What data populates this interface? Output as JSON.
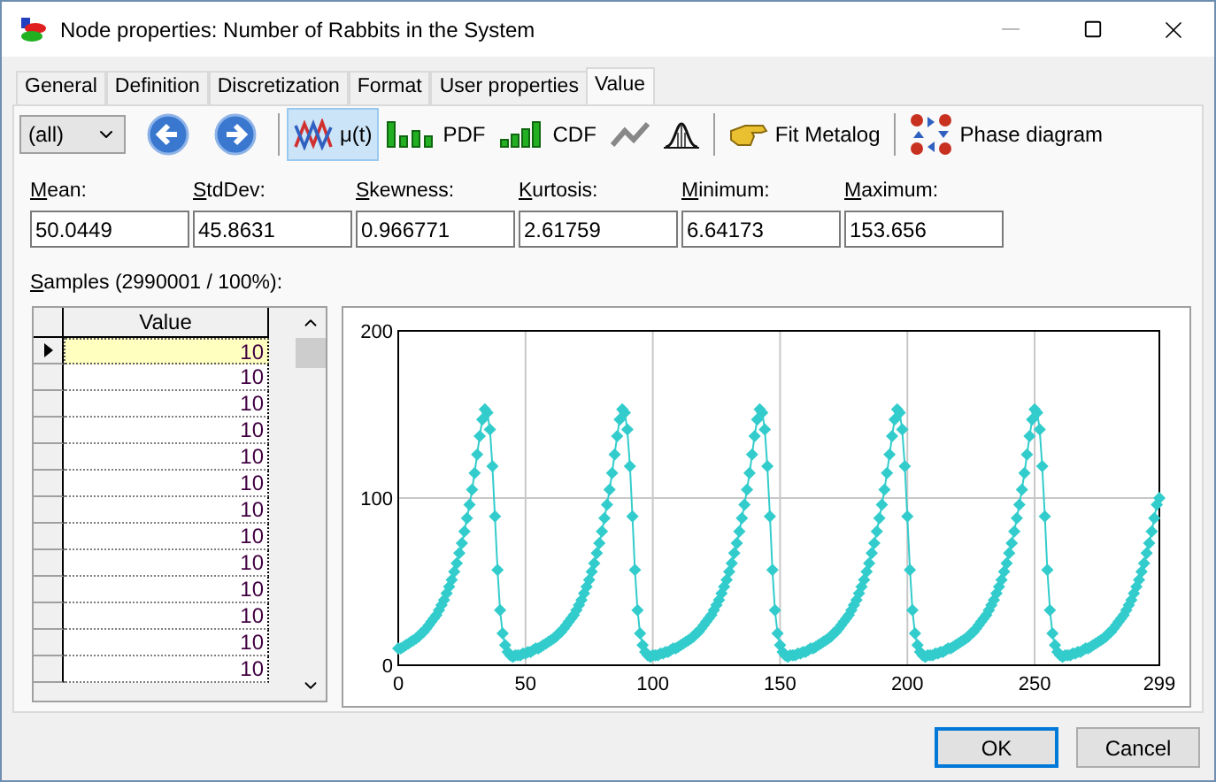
{
  "window": {
    "title": "Node properties: Number of Rabbits in the System"
  },
  "tabs": [
    {
      "label": "General",
      "selected": false
    },
    {
      "label": "Definition",
      "selected": false
    },
    {
      "label": "Discretization",
      "selected": false
    },
    {
      "label": "Format",
      "selected": false
    },
    {
      "label": "User properties",
      "selected": false
    },
    {
      "label": "Value",
      "selected": true
    }
  ],
  "toolbar": {
    "filter": {
      "value": "(all)"
    },
    "groups": [
      [
        {
          "kind": "back"
        },
        {
          "kind": "forward"
        }
      ],
      [
        {
          "kind": "trend",
          "label": "μ(t)",
          "selected": true
        },
        {
          "kind": "pdf",
          "label": "PDF",
          "selected": false
        },
        {
          "kind": "cdf",
          "label": "CDF",
          "selected": false
        },
        {
          "kind": "line",
          "selected": false
        },
        {
          "kind": "bell",
          "selected": false
        }
      ],
      [
        {
          "kind": "fit",
          "label": "Fit Metalog"
        }
      ],
      [
        {
          "kind": "phase",
          "label": "Phase diagram"
        }
      ]
    ]
  },
  "stats": [
    {
      "label": "Mean:",
      "value": "50.0449"
    },
    {
      "label": "StdDev:",
      "value": "45.8631"
    },
    {
      "label": "Skewness:",
      "value": "0.966771"
    },
    {
      "label": "Kurtosis:",
      "value": "2.61759"
    },
    {
      "label": "Minimum:",
      "value": "6.64173"
    },
    {
      "label": "Maximum:",
      "value": "153.656"
    }
  ],
  "samples": {
    "label": "Samples (2990001 / 100%):",
    "columns": [
      "Value"
    ],
    "rows": [
      {
        "value": "10",
        "selected": true
      },
      {
        "value": "10",
        "selected": false
      },
      {
        "value": "10",
        "selected": false
      },
      {
        "value": "10",
        "selected": false
      },
      {
        "value": "10",
        "selected": false
      },
      {
        "value": "10",
        "selected": false
      },
      {
        "value": "10",
        "selected": false
      },
      {
        "value": "10",
        "selected": false
      },
      {
        "value": "10",
        "selected": false
      },
      {
        "value": "10",
        "selected": false
      },
      {
        "value": "10",
        "selected": false
      },
      {
        "value": "10",
        "selected": false
      },
      {
        "value": "10",
        "selected": false
      }
    ]
  },
  "chart": {
    "chart_data": {
      "type": "line",
      "x": [
        0,
        1,
        2,
        3,
        4,
        5,
        6,
        7,
        8,
        9,
        10,
        11,
        12,
        13,
        14,
        15,
        16,
        17,
        18,
        19,
        20,
        21,
        22,
        23,
        24,
        25,
        26,
        27,
        28,
        29,
        30,
        31,
        32,
        33,
        34,
        35,
        36,
        37,
        38,
        39,
        40,
        41,
        42,
        43,
        44,
        45,
        46,
        47,
        48,
        49,
        50,
        51,
        52,
        53,
        54,
        55,
        56,
        57,
        58,
        59,
        60,
        61,
        62,
        63,
        64,
        65,
        66,
        67,
        68,
        69,
        70,
        71,
        72,
        73,
        74,
        75,
        76,
        77,
        78,
        79,
        80,
        81,
        82,
        83,
        84,
        85,
        86,
        87,
        88,
        89,
        90,
        91,
        92,
        93,
        94,
        95,
        96,
        97,
        98,
        99,
        100,
        101,
        102,
        103,
        104,
        105,
        106,
        107,
        108,
        109,
        110,
        111,
        112,
        113,
        114,
        115,
        116,
        117,
        118,
        119,
        120,
        121,
        122,
        123,
        124,
        125,
        126,
        127,
        128,
        129,
        130,
        131,
        132,
        133,
        134,
        135,
        136,
        137,
        138,
        139,
        140,
        141,
        142,
        143,
        144,
        145,
        146,
        147,
        148,
        149,
        150,
        151,
        152,
        153,
        154,
        155,
        156,
        157,
        158,
        159,
        160,
        161,
        162,
        163,
        164,
        165,
        166,
        167,
        168,
        169,
        170,
        171,
        172,
        173,
        174,
        175,
        176,
        177,
        178,
        179,
        180,
        181,
        182,
        183,
        184,
        185,
        186,
        187,
        188,
        189,
        190,
        191,
        192,
        193,
        194,
        195,
        196,
        197,
        198,
        199,
        200,
        201,
        202,
        203,
        204,
        205,
        206,
        207,
        208,
        209,
        210,
        211,
        212,
        213,
        214,
        215,
        216,
        217,
        218,
        219,
        220,
        221,
        222,
        223,
        224,
        225,
        226,
        227,
        228,
        229,
        230,
        231,
        232,
        233,
        234,
        235,
        236,
        237,
        238,
        239,
        240,
        241,
        242,
        243,
        244,
        245,
        246,
        247,
        248,
        249,
        250,
        251,
        252,
        253,
        254,
        255,
        256,
        257,
        258,
        259,
        260,
        261,
        262,
        263,
        264,
        265,
        266,
        267,
        268,
        269,
        270,
        271,
        272,
        273,
        274,
        275,
        276,
        277,
        278,
        279,
        280,
        281,
        282,
        283,
        284,
        285,
        286,
        287,
        288,
        289,
        290,
        291,
        292,
        293,
        294,
        295,
        296,
        297,
        298,
        299
      ],
      "xlim": [
        0,
        299
      ],
      "ylim": [
        0,
        200
      ],
      "xticks": [
        0,
        50,
        100,
        150,
        200,
        250,
        299
      ],
      "yticks": [
        0,
        100,
        200
      ],
      "grid": true,
      "series": [
        {
          "color": "#33cccc",
          "marker": "diamond",
          "values": [
            10,
            10,
            11,
            12,
            13,
            14,
            15,
            16,
            17,
            19,
            20,
            22,
            24,
            26,
            28,
            30,
            33,
            36,
            39,
            43,
            47,
            51,
            56,
            61,
            67,
            73,
            80,
            88,
            96,
            105,
            115,
            126,
            137,
            147,
            153,
            151,
            141,
            119,
            89,
            57,
            33,
            19,
            12,
            8,
            6,
            5,
            6,
            6,
            6,
            7,
            7,
            8,
            8,
            9,
            10,
            10,
            11,
            12,
            13,
            14,
            15,
            16,
            17,
            19,
            20,
            22,
            24,
            26,
            28,
            30,
            33,
            36,
            39,
            43,
            47,
            51,
            56,
            61,
            67,
            73,
            80,
            88,
            96,
            105,
            115,
            126,
            137,
            147,
            153,
            151,
            141,
            119,
            89,
            57,
            33,
            19,
            12,
            8,
            6,
            5,
            6,
            6,
            6,
            7,
            7,
            8,
            8,
            9,
            10,
            10,
            11,
            12,
            13,
            14,
            15,
            16,
            17,
            19,
            20,
            22,
            24,
            26,
            28,
            30,
            33,
            36,
            39,
            43,
            47,
            51,
            56,
            61,
            67,
            73,
            80,
            88,
            96,
            105,
            115,
            126,
            137,
            147,
            153,
            151,
            141,
            119,
            89,
            57,
            33,
            19,
            12,
            8,
            6,
            5,
            6,
            6,
            6,
            7,
            7,
            8,
            8,
            9,
            10,
            10,
            11,
            12,
            13,
            14,
            15,
            16,
            17,
            19,
            20,
            22,
            24,
            26,
            28,
            30,
            33,
            36,
            39,
            43,
            47,
            51,
            56,
            61,
            67,
            73,
            80,
            88,
            96,
            105,
            115,
            126,
            137,
            147,
            153,
            151,
            141,
            119,
            89,
            57,
            33,
            19,
            12,
            8,
            6,
            5,
            6,
            6,
            6,
            7,
            7,
            8,
            8,
            9,
            10,
            10,
            11,
            12,
            13,
            14,
            15,
            16,
            17,
            19,
            20,
            22,
            24,
            26,
            28,
            30,
            33,
            36,
            39,
            43,
            47,
            51,
            56,
            61,
            67,
            73,
            80,
            88,
            96,
            105,
            115,
            126,
            137,
            147,
            153,
            151,
            141,
            119,
            89,
            57,
            33,
            19,
            12,
            8,
            6,
            5,
            6,
            6,
            6,
            7,
            7,
            8,
            8,
            9,
            10,
            10,
            11,
            12,
            13,
            14,
            15,
            16,
            17,
            19,
            20,
            22,
            24,
            26,
            28,
            30,
            33,
            36,
            39,
            43,
            47,
            51,
            56,
            61,
            67,
            73,
            80,
            88,
            96,
            100
          ]
        }
      ]
    }
  },
  "buttons": [
    {
      "label": "OK",
      "kind": "default"
    },
    {
      "label": "Cancel",
      "kind": "normal"
    }
  ]
}
